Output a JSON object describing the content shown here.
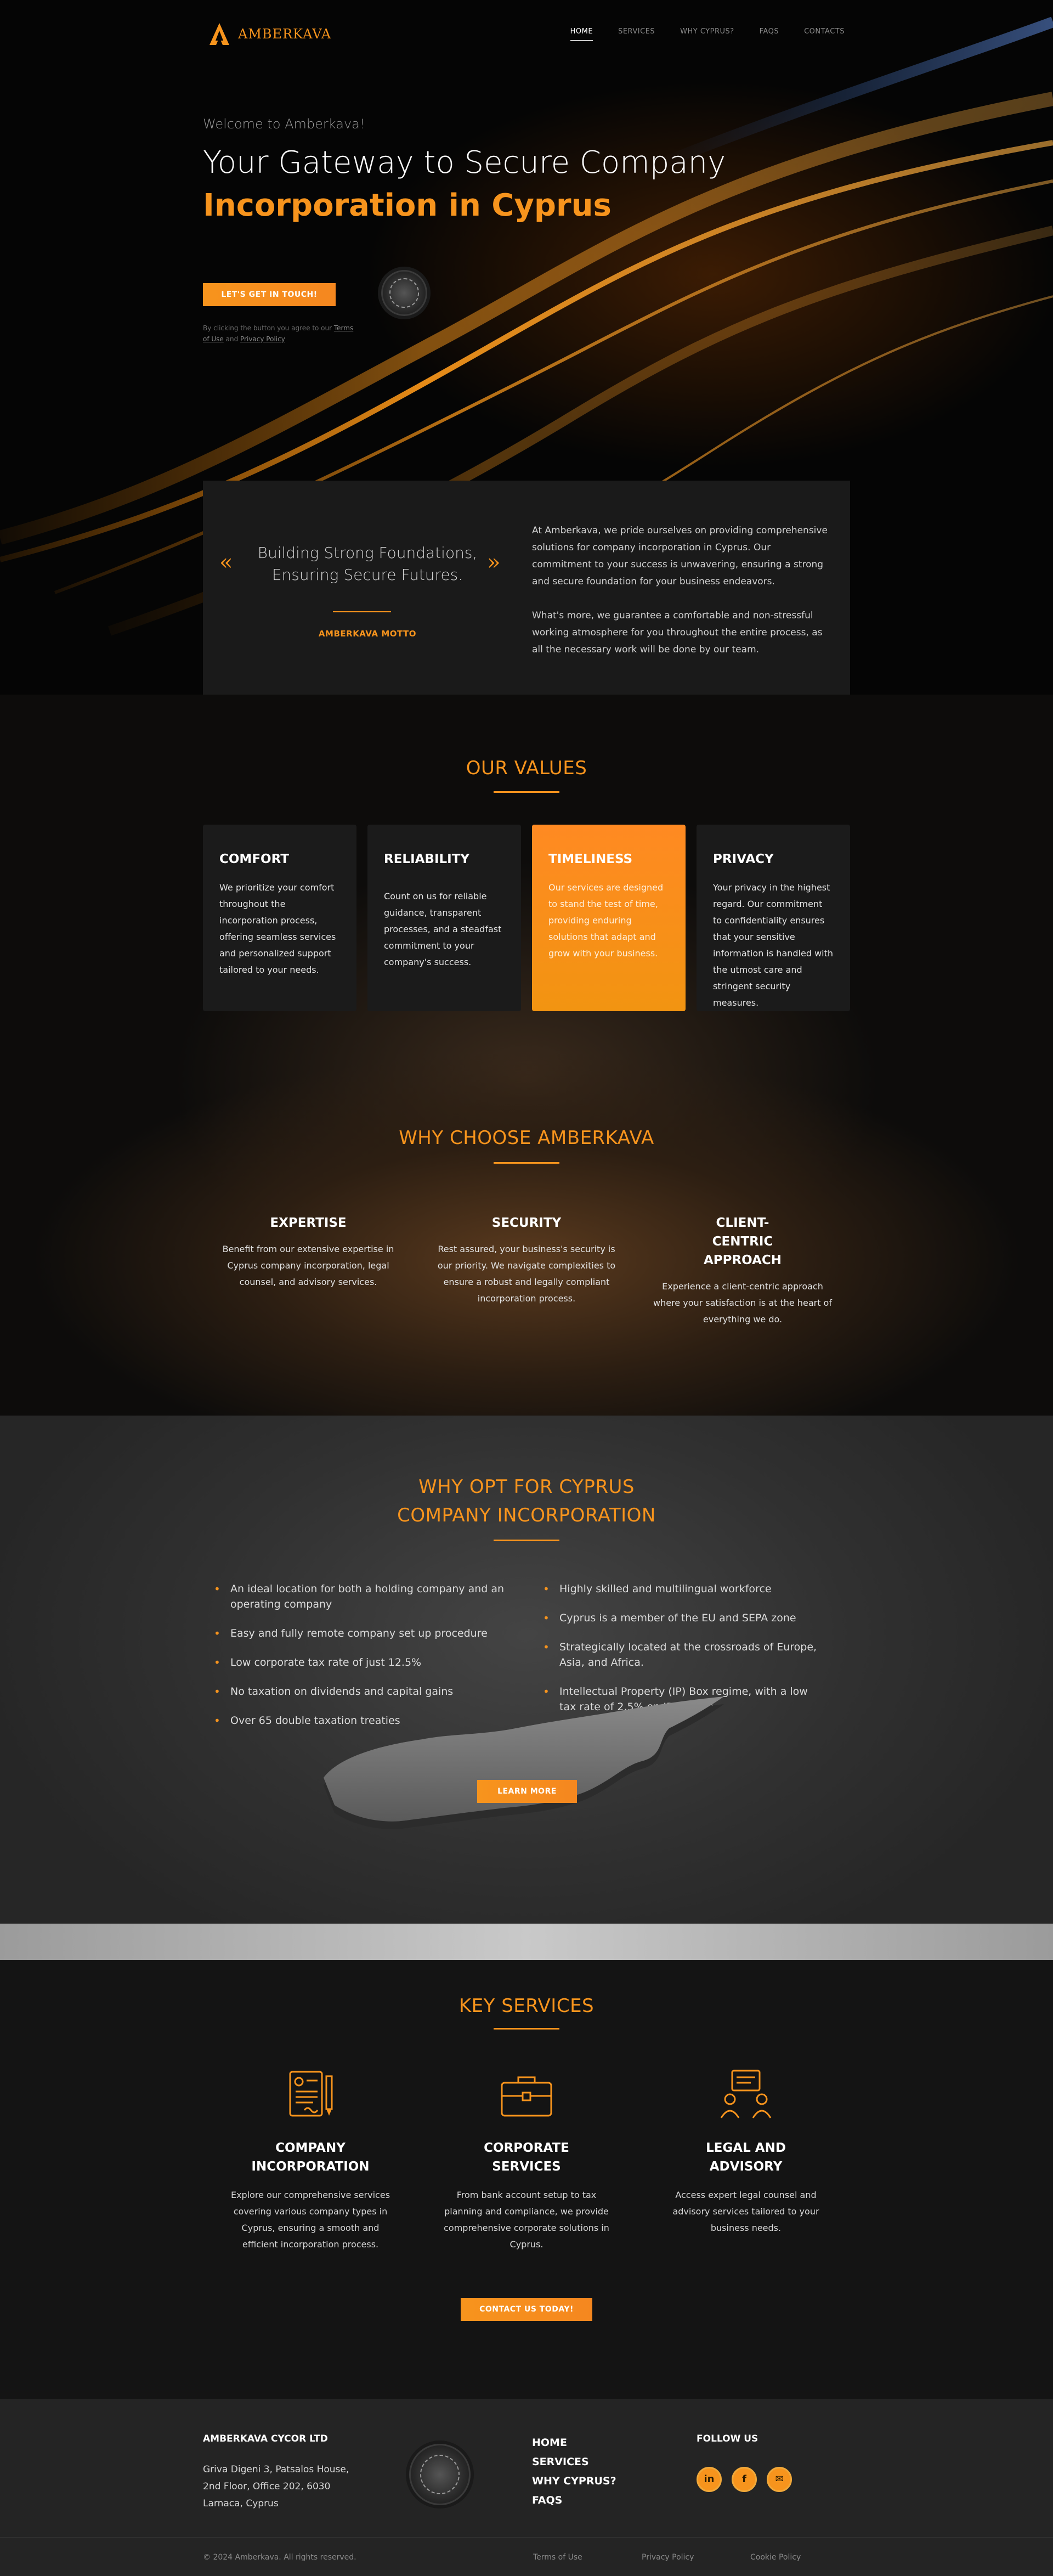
{
  "brand": {
    "name": "AMBERKAVA",
    "accent": "#f7941d"
  },
  "nav": {
    "items": [
      {
        "label": "HOME",
        "active": true
      },
      {
        "label": "SERVICES",
        "active": false
      },
      {
        "label": "WHY CYPRUS?",
        "active": false
      },
      {
        "label": "FAQS",
        "active": false
      },
      {
        "label": "CONTACTS",
        "active": false
      }
    ]
  },
  "hero": {
    "welcome": "Welcome to Amberkava!",
    "title_line1": "Your Gateway to Secure Company",
    "title_line2": "Incorporation in Cyprus",
    "cta": "LET'S GET IN TOUCH!",
    "disclaimer_pre": "By clicking the button you agree to our ",
    "terms": "Terms of Use",
    "and": " and ",
    "privacy": "Privacy Policy"
  },
  "motto": {
    "text": "Building Strong Foundations, Ensuring Secure Futures.",
    "label": "AMBERKAVA MOTTO",
    "p1": "At Amberkava, we pride ourselves on providing comprehensive solutions for company incorporation in Cyprus. Our commitment to your success is unwavering, ensuring a strong and secure foundation for your business endeavors.",
    "p2": "What's more, we guarantee a comfortable and non-stressful working atmosphere for you throughout the entire process, as all the necessary work will be done by our team."
  },
  "values": {
    "title": "OUR VALUES",
    "cards": [
      {
        "title": "COMFORT",
        "text": "We prioritize your comfort throughout the incorporation process, offering seamless services and personalized support tailored to your needs."
      },
      {
        "title": "RELIABILITY",
        "text": "Count on us for reliable guidance, transparent processes, and a steadfast commitment to your company's success."
      },
      {
        "title": "TIMELINESS",
        "text": "Our services are designed to stand the test of time, providing enduring solutions that adapt and grow with your business."
      },
      {
        "title": "PRIVACY",
        "text": "Your privacy in the highest regard. Our commitment to confidentiality ensures that your sensitive information is handled with the utmost care and stringent security measures."
      }
    ]
  },
  "why": {
    "title": "WHY CHOOSE AMBERKAVA",
    "cols": [
      {
        "title": "EXPERTISE",
        "text": "Benefit from our extensive expertise in Cyprus company incorporation, legal counsel, and advisory services."
      },
      {
        "title": "SECURITY",
        "text": "Rest assured, your business's security is our priority. We navigate complexities to ensure a robust and legally compliant incorporation process."
      },
      {
        "title": "CLIENT-CENTRIC APPROACH",
        "text": "Experience a client-centric approach where your satisfaction is at the heart of everything we do."
      }
    ]
  },
  "cyprus": {
    "title_line1": "WHY OPT FOR CYPRUS",
    "title_line2": "COMPANY INCORPORATION",
    "left": [
      "An ideal location for both a holding company and an operating company",
      "Easy and fully remote company set up procedure",
      "Low corporate tax rate of just 12.5%",
      "No taxation on dividends and capital gains",
      "Over 65 double taxation treaties"
    ],
    "right": [
      "Highly skilled and multilingual workforce",
      "Cyprus is a member of the EU and SEPA zone",
      "Strategically located at the crossroads of Europe, Asia, and Africa.",
      "Intellectual Property (IP) Box regime, with a low tax rate of 2.5% on IP income"
    ],
    "cta": "LEARN MORE"
  },
  "services": {
    "title": "KEY SERVICES",
    "items": [
      {
        "title": "COMPANY INCORPORATION",
        "text": "Explore our comprehensive services covering various company types in Cyprus, ensuring a smooth and efficient incorporation process.",
        "icon": "document-pen-icon"
      },
      {
        "title": "CORPORATE SERVICES",
        "text": "From bank account setup to tax planning and compliance, we provide comprehensive corporate solutions in Cyprus.",
        "icon": "briefcase-icon"
      },
      {
        "title": "LEGAL AND ADVISORY",
        "text": "Access expert legal counsel and advisory services tailored to your business needs.",
        "icon": "consultation-icon"
      }
    ],
    "cta": "CONTACT US TODAY!"
  },
  "footer": {
    "company": "AMBERKAVA CYCOR LTD",
    "address": [
      "Griva Digeni 3, Patsalos House,",
      "2nd Floor, Office 202, 6030",
      "Larnaca, Cyprus"
    ],
    "nav": [
      "HOME",
      "SERVICES",
      "WHY CYPRUS?",
      "FAQS"
    ],
    "follow": "FOLLOW US",
    "social": [
      {
        "name": "linkedin-icon",
        "glyph": "in"
      },
      {
        "name": "facebook-icon",
        "glyph": "f"
      },
      {
        "name": "email-icon",
        "glyph": "✉"
      }
    ],
    "copyright": "© 2024 Amberkava. All rights reserved.",
    "links": [
      "Terms of Use",
      "Privacy Policy",
      "Cookie Policy"
    ]
  }
}
